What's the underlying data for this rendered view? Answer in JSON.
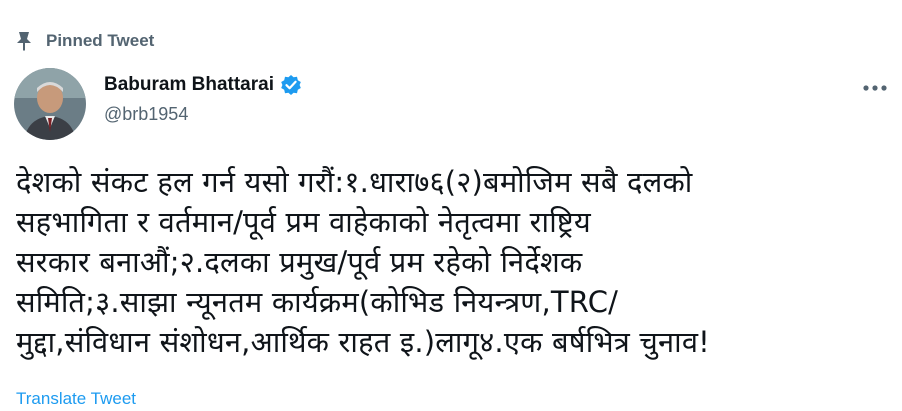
{
  "pinned": {
    "label": "Pinned Tweet",
    "icon": "pin-icon"
  },
  "author": {
    "display_name": "Baburam Bhattarai",
    "handle": "@brb1954",
    "verified": true,
    "verified_color": "#1d9bf0",
    "avatar_icon": "avatar"
  },
  "tweet": {
    "text": "देशको संकट हल गर्न यसो गरौं:१.धारा७६(२)बमोजिम सबै दलको\nसहभागिता र वर्तमान/पूर्व प्रम वाहेकाको नेतृत्वमा राष्ट्रिय\nसरकार बनाऔं;२.दलका प्रमुख/पूर्व प्रम रहेको निर्देशक\nसमिति;३.साझा न्यूनतम कार्यक्रम(कोभिड नियन्त्रण,TRC/\nमुद्दा,संविधान संशोधन,आर्थिक राहत इ.)लागू४.एक बर्षभित्र चुनाव!"
  },
  "actions": {
    "translate_label": "Translate Tweet",
    "more_icon": "more-icon"
  },
  "colors": {
    "text": "#0f1419",
    "secondary": "#536471",
    "link": "#1d9bf0"
  }
}
